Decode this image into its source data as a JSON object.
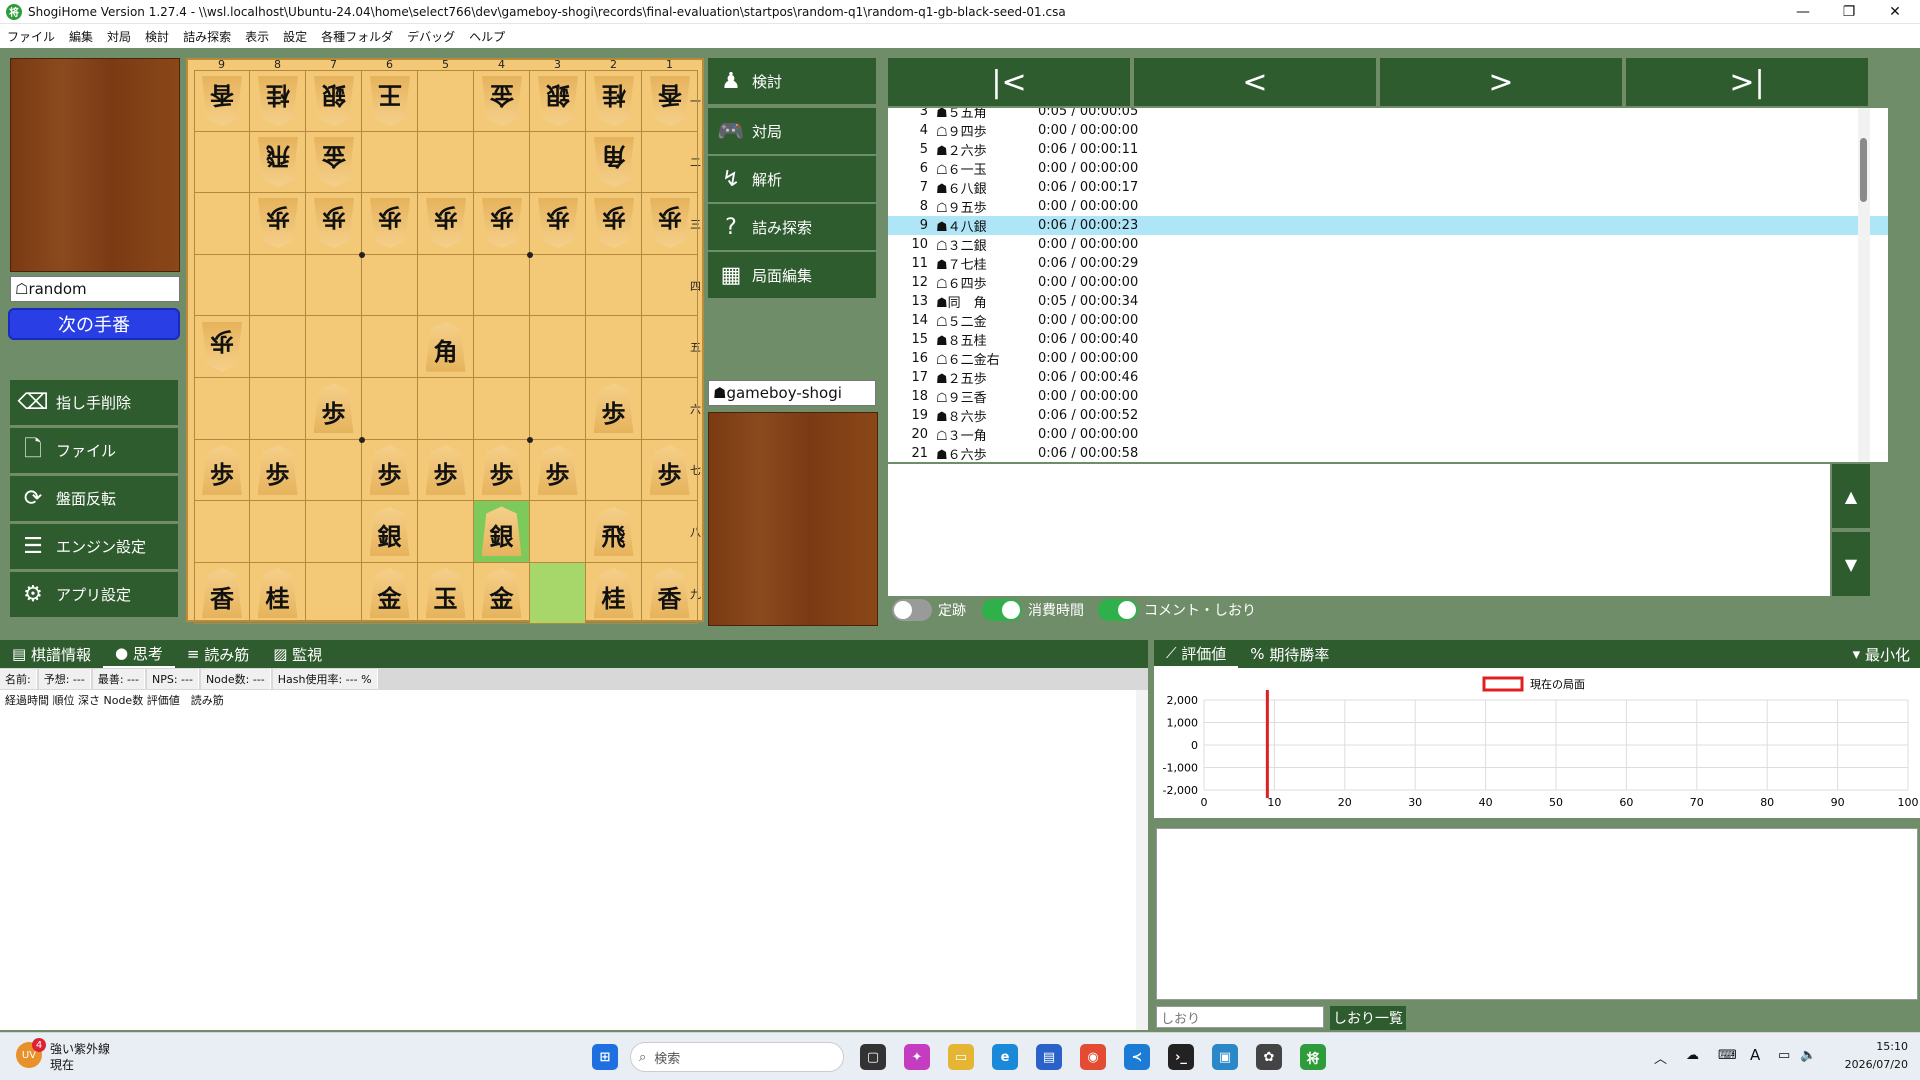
{
  "window": {
    "title": "ShogiHome Version 1.27.4 - \\\\wsl.localhost\\Ubuntu-24.04\\home\\select766\\dev\\gameboy-shogi\\records\\final-evaluation\\startpos\\random-q1\\random-q1-gb-black-seed-01.csa"
  },
  "menu": [
    "ファイル",
    "編集",
    "対局",
    "検討",
    "詰み探索",
    "表示",
    "設定",
    "各種フォルダ",
    "デバッグ",
    "ヘルプ"
  ],
  "players": {
    "gote_name": "☖random",
    "sente_name": "☗gameboy-shogi",
    "next_turn": "次の手番"
  },
  "left_buttons": [
    {
      "label": "指し手削除",
      "icon": "delete-icon"
    },
    {
      "label": "ファイル",
      "icon": "file-icon"
    },
    {
      "label": "盤面反転",
      "icon": "flip-icon"
    },
    {
      "label": "エンジン設定",
      "icon": "engine-icon"
    },
    {
      "label": "アプリ設定",
      "icon": "gear-icon"
    }
  ],
  "mid_buttons": [
    {
      "label": "検討",
      "icon": "pawn-icon"
    },
    {
      "label": "対局",
      "icon": "gamepad-icon"
    },
    {
      "label": "解析",
      "icon": "analysis-icon"
    },
    {
      "label": "詰み探索",
      "icon": "question-icon"
    },
    {
      "label": "局面編集",
      "icon": "grid-icon"
    }
  ],
  "board": {
    "files": [
      "9",
      "8",
      "7",
      "6",
      "5",
      "4",
      "3",
      "2",
      "1"
    ],
    "ranks": [
      "一",
      "二",
      "三",
      "四",
      "五",
      "六",
      "七",
      "八",
      "九"
    ],
    "rows": [
      [
        [
          "香",
          "g"
        ],
        [
          "桂",
          "g"
        ],
        [
          "銀",
          "g"
        ],
        [
          "王",
          "g"
        ],
        null,
        [
          "金",
          "g"
        ],
        [
          "銀",
          "g"
        ],
        [
          "桂",
          "g"
        ],
        [
          "香",
          "g"
        ]
      ],
      [
        null,
        [
          "飛",
          "g"
        ],
        [
          "金",
          "g"
        ],
        null,
        null,
        null,
        null,
        [
          "角",
          "g"
        ],
        null
      ],
      [
        null,
        [
          "歩",
          "g"
        ],
        [
          "歩",
          "g"
        ],
        [
          "歩",
          "g"
        ],
        [
          "歩",
          "g"
        ],
        [
          "歩",
          "g"
        ],
        [
          "歩",
          "g"
        ],
        [
          "歩",
          "g"
        ],
        [
          "歩",
          "g"
        ]
      ],
      [
        null,
        null,
        null,
        null,
        null,
        null,
        null,
        null,
        null
      ],
      [
        [
          "歩",
          "g"
        ],
        null,
        null,
        null,
        [
          "角",
          "s"
        ],
        null,
        null,
        null,
        null
      ],
      [
        null,
        null,
        [
          "歩",
          "s"
        ],
        null,
        null,
        null,
        null,
        [
          "歩",
          "s"
        ],
        null
      ],
      [
        [
          "歩",
          "s"
        ],
        [
          "歩",
          "s"
        ],
        null,
        [
          "歩",
          "s"
        ],
        [
          "歩",
          "s"
        ],
        [
          "歩",
          "s"
        ],
        [
          "歩",
          "s"
        ],
        null,
        [
          "歩",
          "s"
        ]
      ],
      [
        null,
        null,
        null,
        [
          "銀",
          "s"
        ],
        null,
        [
          "銀",
          "s"
        ],
        null,
        [
          "飛",
          "s"
        ],
        null
      ],
      [
        [
          "香",
          "s"
        ],
        [
          "桂",
          "s"
        ],
        null,
        [
          "金",
          "s"
        ],
        [
          "玉",
          "s"
        ],
        [
          "金",
          "s"
        ],
        null,
        [
          "桂",
          "s"
        ],
        [
          "香",
          "s"
        ]
      ]
    ]
  },
  "kifu_nav": [
    "|<",
    "<",
    ">",
    ">|"
  ],
  "kifu": [
    {
      "n": "3",
      "m": "☗５五角",
      "t": "0:05 / 00:00:05"
    },
    {
      "n": "4",
      "m": "☖９四歩",
      "t": "0:00 / 00:00:00"
    },
    {
      "n": "5",
      "m": "☗２六歩",
      "t": "0:06 / 00:00:11"
    },
    {
      "n": "6",
      "m": "☖６一玉",
      "t": "0:00 / 00:00:00"
    },
    {
      "n": "7",
      "m": "☗６八銀",
      "t": "0:06 / 00:00:17"
    },
    {
      "n": "8",
      "m": "☖９五歩",
      "t": "0:00 / 00:00:00"
    },
    {
      "n": "9",
      "m": "☗４八銀",
      "t": "0:06 / 00:00:23"
    },
    {
      "n": "10",
      "m": "☖３二銀",
      "t": "0:00 / 00:00:00"
    },
    {
      "n": "11",
      "m": "☗７七桂",
      "t": "0:06 / 00:00:29"
    },
    {
      "n": "12",
      "m": "☖６四歩",
      "t": "0:00 / 00:00:00"
    },
    {
      "n": "13",
      "m": "☗同　角",
      "t": "0:05 / 00:00:34"
    },
    {
      "n": "14",
      "m": "☖５二金",
      "t": "0:00 / 00:00:00"
    },
    {
      "n": "15",
      "m": "☗８五桂",
      "t": "0:06 / 00:00:40"
    },
    {
      "n": "16",
      "m": "☖６二金右",
      "t": "0:00 / 00:00:00"
    },
    {
      "n": "17",
      "m": "☗２五歩",
      "t": "0:06 / 00:00:46"
    },
    {
      "n": "18",
      "m": "☖９三香",
      "t": "0:00 / 00:00:00"
    },
    {
      "n": "19",
      "m": "☗８六歩",
      "t": "0:06 / 00:00:52"
    },
    {
      "n": "20",
      "m": "☖３一角",
      "t": "0:00 / 00:00:00"
    },
    {
      "n": "21",
      "m": "☗６六歩",
      "t": "0:06 / 00:00:58"
    }
  ],
  "kifu_selected_index": 6,
  "toggles": [
    {
      "label": "定跡",
      "on": false
    },
    {
      "label": "消費時間",
      "on": true
    },
    {
      "label": "コメント・しおり",
      "on": true
    }
  ],
  "bottom_tabs": [
    "棋譜情報",
    "思考",
    "読み筋",
    "監視"
  ],
  "think_info": [
    "名前:",
    "予想: ---",
    "最善: ---",
    "NPS: ---",
    "Node数: ---",
    "Hash使用率: --- %"
  ],
  "think_header": "経過時間 順位 深さ Node数 評価値　読み筋",
  "right_tabs": {
    "eval": "評価値",
    "win": "期待勝率",
    "minimize": "最小化"
  },
  "chart_data": {
    "type": "line",
    "legend": "現在の局面",
    "y_ticks": [
      "2,000",
      "1,000",
      "0",
      "-1,000",
      "-2,000"
    ],
    "x_ticks": [
      "0",
      "10",
      "20",
      "30",
      "40",
      "50",
      "60",
      "70",
      "80",
      "90",
      "100"
    ],
    "ylim": [
      -2000,
      2000
    ],
    "xlim": [
      0,
      100
    ],
    "current_position_x": 9,
    "series": []
  },
  "bookmark": {
    "placeholder": "しおり",
    "button": "しおり一覧"
  },
  "taskbar": {
    "weather_badge": "4",
    "weather_text": "強い紫外線",
    "weather_sub": "現在",
    "search": "検索",
    "time": "15:10",
    "date": "2026/07/20"
  }
}
